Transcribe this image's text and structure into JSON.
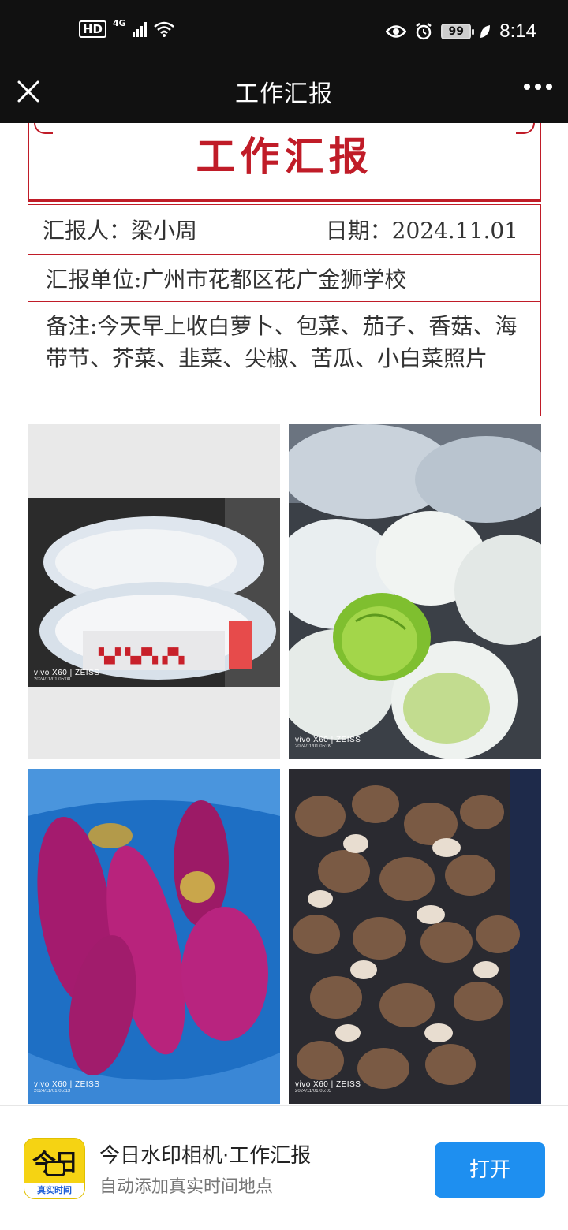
{
  "status_bar": {
    "hd": "HD",
    "network": "4G",
    "battery": "99",
    "time": "8:14",
    "icons": [
      "signal-icon",
      "wifi-icon",
      "eye-icon",
      "alarm-icon",
      "battery-icon",
      "leaf-icon"
    ]
  },
  "nav": {
    "title": "工作汇报",
    "icons": [
      "close-icon",
      "more-icon"
    ]
  },
  "report": {
    "title": "工作汇报",
    "reporter": "汇报人：梁小周",
    "date": "日期：2024.11.01",
    "unit": "汇报单位:广州市花都区花广金狮学校",
    "note": "备注:今天早上收白萝卜、包菜、茄子、香菇、海带节、芥菜、韭菜、尖椒、苦瓜、小白菜照片",
    "accent_color": "#c01c28"
  },
  "photos": [
    {
      "brand": "vivo X60 | ZEISS",
      "timestamp": "2024/11/01 05:08"
    },
    {
      "brand": "vivo X60 | ZEISS",
      "timestamp": "2024/11/01 05:09"
    },
    {
      "brand": "vivo X60 | ZEISS",
      "timestamp": "2024/11/01 05:13"
    },
    {
      "brand": "vivo X60 | ZEISS",
      "timestamp": "2024/11/01 05:03"
    }
  ],
  "promo": {
    "icon_big": "今日",
    "icon_sub": "真实时间",
    "title": "今日水印相机·工作汇报",
    "subtitle": "自动添加真实时间地点",
    "open_label": "打开",
    "button_color": "#1e8ff0"
  }
}
